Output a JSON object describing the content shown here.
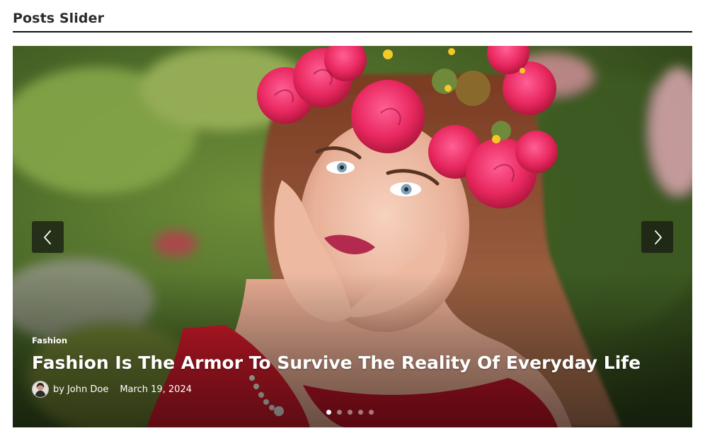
{
  "widget": {
    "title": "Posts Slider"
  },
  "slide": {
    "category": "Fashion",
    "title": "Fashion Is The Armor To Survive The Reality Of Everyday Life",
    "author_prefix": "by",
    "author": "John Doe",
    "date": "March 19, 2024"
  },
  "navigation": {
    "prev_icon": "chevron-left-icon",
    "next_icon": "chevron-right-icon",
    "dot_count": 5,
    "active_dot": 1
  },
  "colors": {
    "title_text": "#2b2b2b",
    "header_rule": "#111111",
    "nav_button_bg": "#141612",
    "caption_text": "#ffffff"
  }
}
